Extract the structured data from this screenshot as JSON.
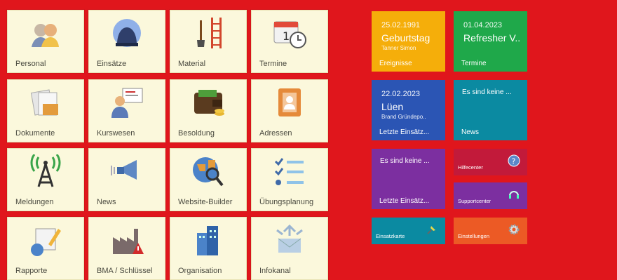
{
  "modules": [
    {
      "label": "Personal",
      "icon": "people-icon"
    },
    {
      "label": "Einsätze",
      "icon": "helmet-icon"
    },
    {
      "label": "Material",
      "icon": "shovel-ladder-icon"
    },
    {
      "label": "Termine",
      "icon": "calendar-clock-icon"
    },
    {
      "label": "Dokumente",
      "icon": "documents-icon"
    },
    {
      "label": "Kurswesen",
      "icon": "presentation-icon"
    },
    {
      "label": "Besoldung",
      "icon": "wallet-icon"
    },
    {
      "label": "Adressen",
      "icon": "address-book-icon"
    },
    {
      "label": "Meldungen",
      "icon": "antenna-icon"
    },
    {
      "label": "News",
      "icon": "megaphone-icon"
    },
    {
      "label": "Website-Builder",
      "icon": "globe-search-icon"
    },
    {
      "label": "Übungsplanung",
      "icon": "checklist-icon"
    },
    {
      "label": "Rapporte",
      "icon": "report-pencil-icon"
    },
    {
      "label": "BMA / Schlüssel",
      "icon": "factory-alarm-icon"
    },
    {
      "label": "Organisation",
      "icon": "buildings-icon"
    },
    {
      "label": "Infokanal",
      "icon": "envelope-icon"
    }
  ],
  "widgets": {
    "ereignisse": {
      "date": "25.02.1991",
      "title": "Geburtstag",
      "subtitle": "Tanner Simon",
      "footer": "Ereignisse",
      "color": "#f5ae0a"
    },
    "termine": {
      "date": "01.04.2023",
      "title": "Refresher V..",
      "footer": "Termine",
      "color": "#1fa84a"
    },
    "einsaetze": {
      "date": "22.02.2023",
      "title": "Lüen",
      "subtitle": "Brand Gründepo..",
      "footer": "Letzte Einsätz...",
      "color": "#2b55b4"
    },
    "news": {
      "message": "Es sind keine ...",
      "footer": "News",
      "color": "#0b8aa1"
    },
    "einsaetze2": {
      "message": "Es sind keine ...",
      "footer": "Letzte Einsätz...",
      "color": "#7c2fa0"
    },
    "hilfecenter": {
      "footer": "Hilfecenter",
      "icon": "help-icon",
      "color": "#c21a3a"
    },
    "supportcenter": {
      "footer": "Supportcenter",
      "icon": "headset-icon",
      "color": "#7c2fa0"
    },
    "einsatzkarte": {
      "footer": "Einsatzkarte",
      "icon": "pin-icon",
      "color": "#0b8aa1"
    },
    "einstellungen": {
      "footer": "Einstellungen",
      "icon": "gear-icon",
      "color": "#ec5a25"
    }
  }
}
